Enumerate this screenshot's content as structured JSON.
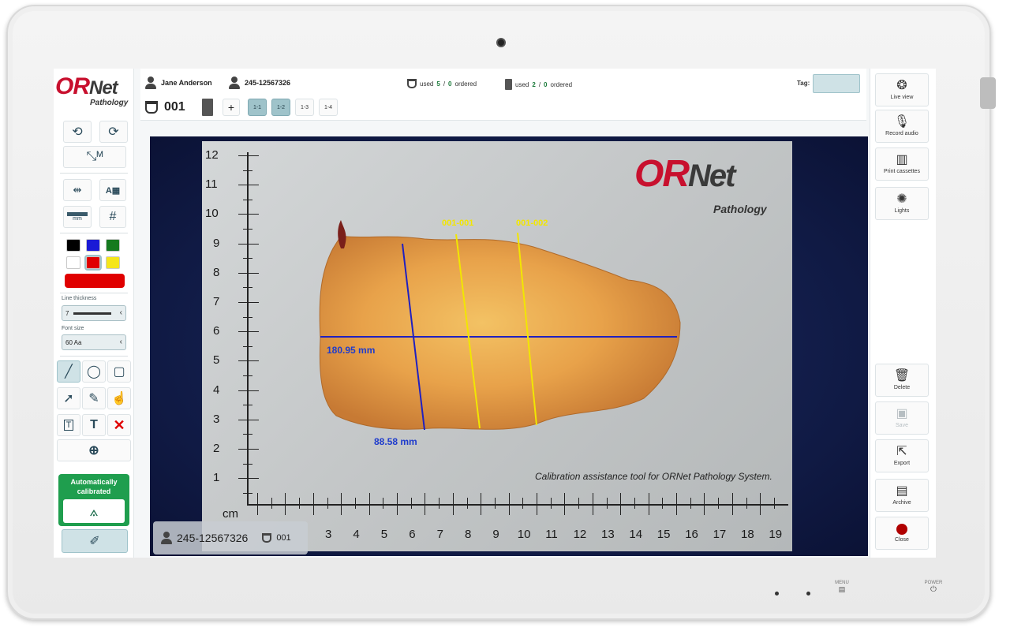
{
  "app": {
    "logo_brand_red": "OR",
    "logo_brand_dark": "Net",
    "logo_sub": "Pathology"
  },
  "header": {
    "user_name": "Jane Anderson",
    "case_id": "245-12567326",
    "containers_used": "5",
    "containers_ordered": "0",
    "containers_label_used": "used",
    "containers_label_ordered": "ordered",
    "cassettes_used": "2",
    "cassettes_ordered": "0",
    "tag_label": "Tag:",
    "sample_number": "001",
    "add_label": "+",
    "chips": [
      {
        "label": "1-1",
        "active": true
      },
      {
        "label": "1-2",
        "active": true
      },
      {
        "label": "1-3",
        "active": false
      },
      {
        "label": "1-4",
        "active": false
      }
    ]
  },
  "left_toolbar": {
    "line_thickness_label": "Line thickness",
    "line_thickness_value": "7",
    "font_size_label": "Font size",
    "font_size_value": "60 Aa",
    "unit_label": "mm",
    "colors": [
      "#000000",
      "#1a1ad6",
      "#157a1e",
      "#ffffff",
      "#e00000",
      "#f5e61a"
    ],
    "selected_color": "#e00000",
    "calibration_status": "Automatically calibrated"
  },
  "viewer": {
    "photo_logo_red": "OR",
    "photo_logo_dark": "Net",
    "photo_logo_sub": "Pathology",
    "caption": "Calibration assistance tool for ORNet Pathology System.",
    "ruler_unit": "cm",
    "ruler_y_labels": [
      "12",
      "11",
      "10",
      "9",
      "8",
      "7",
      "6",
      "5",
      "4",
      "3",
      "2",
      "1"
    ],
    "ruler_x_labels": [
      "3",
      "4",
      "5",
      "6",
      "7",
      "8",
      "9",
      "10",
      "11",
      "12",
      "13",
      "14",
      "15",
      "16",
      "17",
      "18",
      "19"
    ],
    "measure_length": "180.95 mm",
    "measure_width": "88.58 mm",
    "cut_1": "001-001",
    "cut_2": "001-002",
    "overlay_case_id": "245-12567326",
    "overlay_sample": "001"
  },
  "right_toolbar": {
    "items": [
      {
        "label": "Live view",
        "icon": "aperture-icon"
      },
      {
        "label": "Record audio",
        "icon": "microphone-icon"
      },
      {
        "label": "Print cassettes",
        "icon": "print-cassette-icon"
      },
      {
        "label": "Lights",
        "icon": "lights-icon"
      },
      {
        "label": "Delete",
        "icon": "trash-icon"
      },
      {
        "label": "Save",
        "icon": "save-icon"
      },
      {
        "label": "Export",
        "icon": "export-icon"
      },
      {
        "label": "Archive",
        "icon": "archive-icon"
      },
      {
        "label": "Close",
        "icon": "close-dot-icon"
      }
    ]
  },
  "bezel": {
    "menu_label": "MENU",
    "power_label": "POWER"
  }
}
